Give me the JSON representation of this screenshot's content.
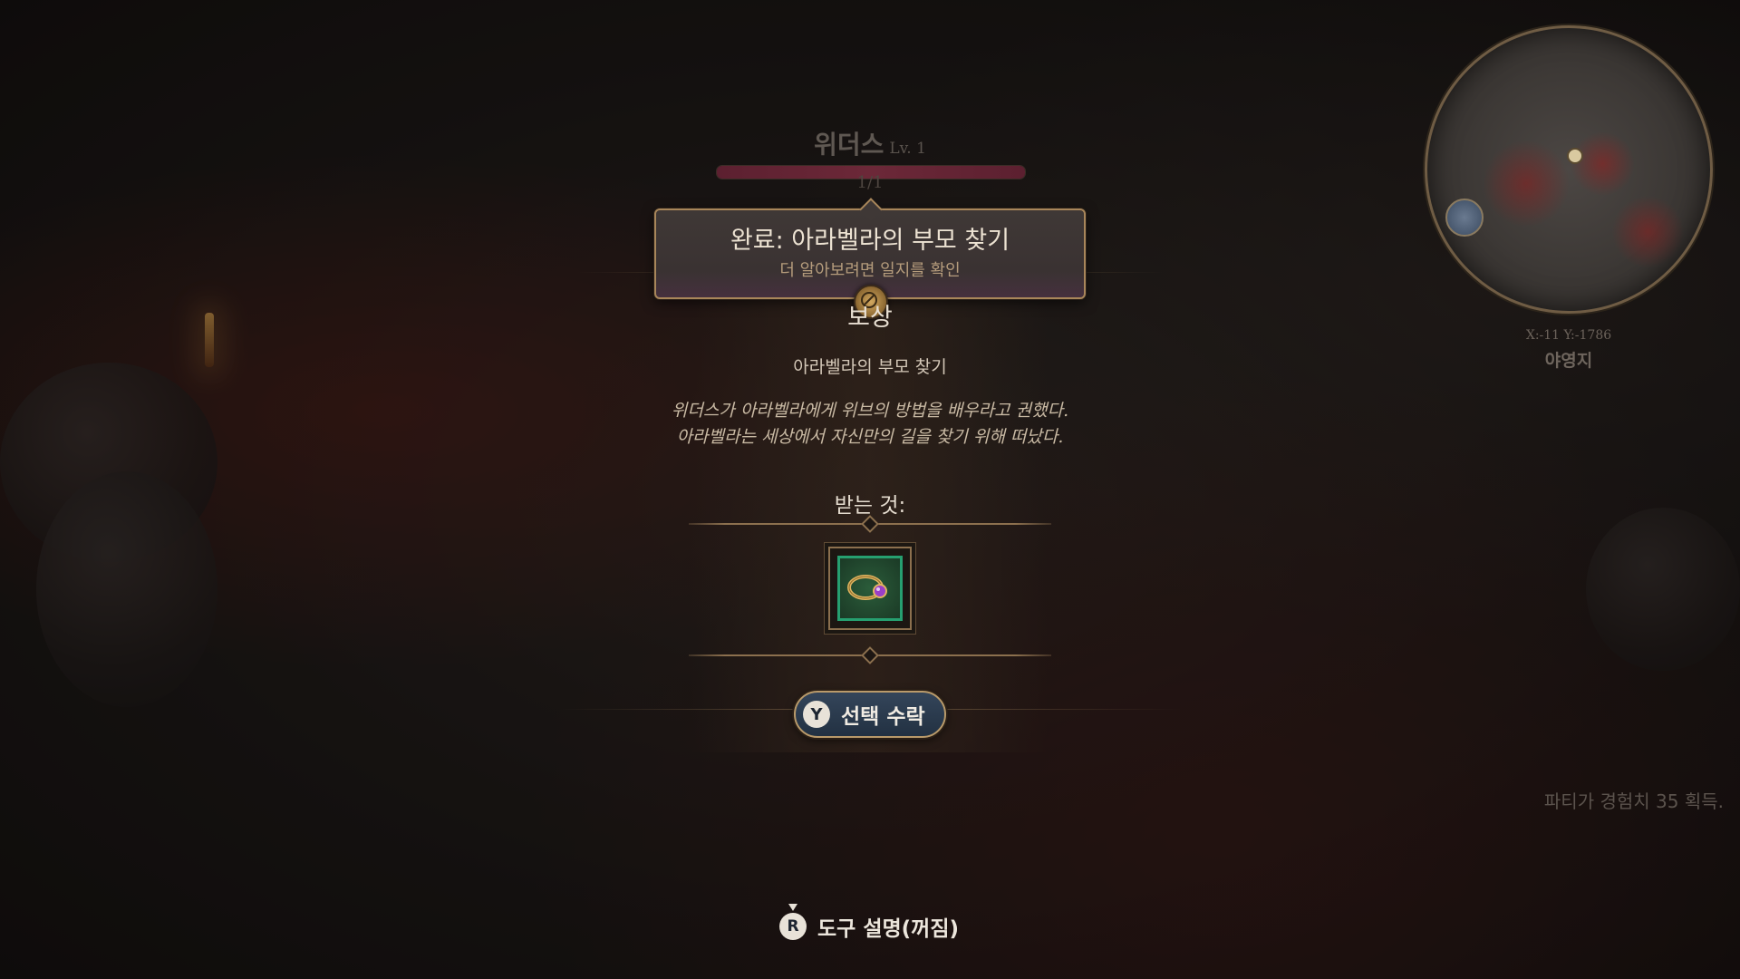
{
  "character": {
    "name": "위더스",
    "level": "Lv. 1",
    "hp_text": "1/1",
    "hp_fraction": 1.0
  },
  "banner": {
    "title": "완료: 아라벨라의 부모 찾기",
    "subtitle": "더 알아보려면 일지를 확인"
  },
  "reward": {
    "heading": "보상",
    "quest_name": "아라벨라의 부모 찾기",
    "description_lines": [
      "위더스가 아라벨라에게 위브의 방법을 배우라고 권했다.",
      "아라벨라는 세상에서 자신만의 길을 찾기 위해 떠났다."
    ],
    "receive_label": "받는 것:",
    "item_icon": "ring-icon"
  },
  "accept_button": {
    "glyph": "Y",
    "label": "선택 수락"
  },
  "hint": {
    "glyph": "R",
    "label": "도구 설명(꺼짐)"
  },
  "minimap": {
    "coords": "X:-11 Y:-1786",
    "location": "야영지"
  },
  "notification": {
    "xp_text": "파티가 경험치 35 획득."
  },
  "colors": {
    "item_border": "#26a070",
    "frame_gold": "#a8865a",
    "button_bg": "#2c3b4e"
  }
}
